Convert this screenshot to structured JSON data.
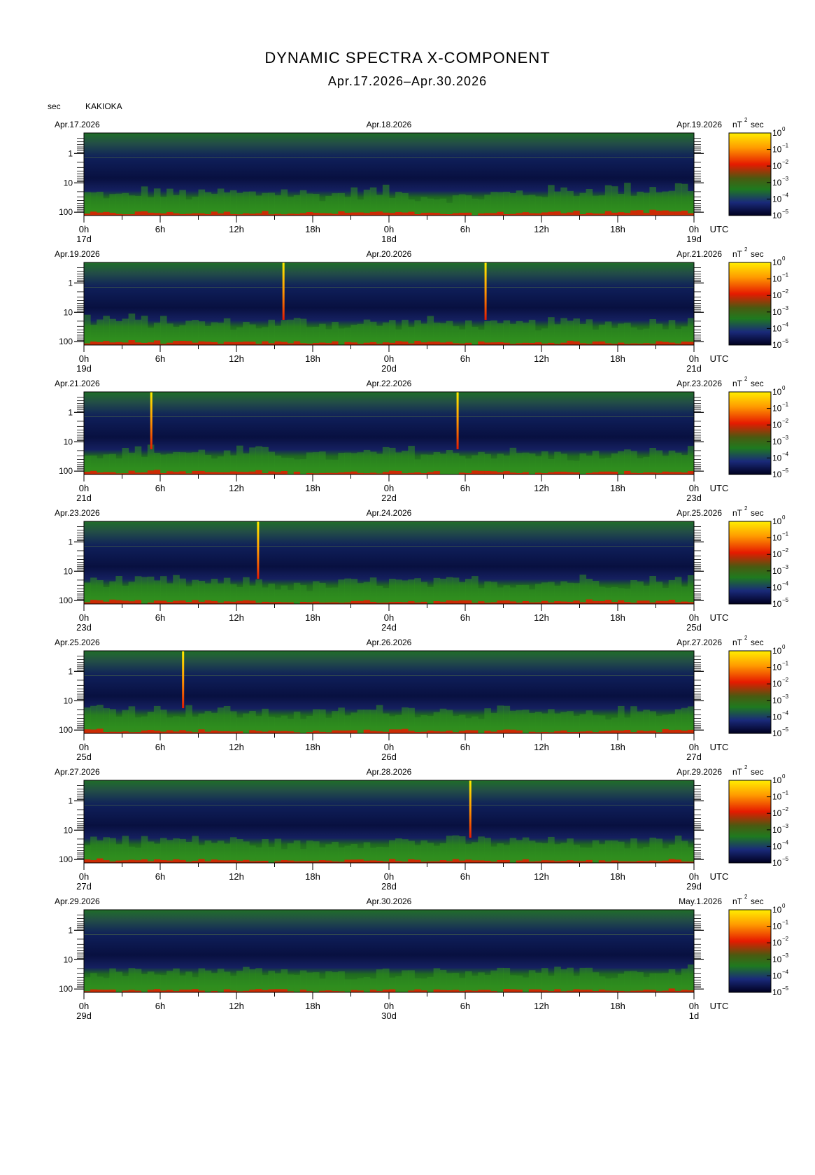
{
  "chart_data": {
    "type": "heatmap",
    "title": "DYNAMIC SPECTRA X-COMPONENT",
    "subtitle": "Apr.17.2026–Apr.30.2026",
    "station": "KAKIOKA",
    "y_unit": "sec",
    "y_ticks": [
      "1",
      "10",
      "100"
    ],
    "y_range_sec": [
      0.2,
      130
    ],
    "x_ticks": [
      "0h",
      "6h",
      "12h",
      "18h",
      "0h",
      "6h",
      "12h",
      "18h",
      "0h"
    ],
    "x_unit": "UTC",
    "colorbar_unit_base": "nT",
    "colorbar_unit_exp": "2",
    "colorbar_unit_suffix": "sec",
    "colorbar_base": "10",
    "colorbar_exponents": [
      "0",
      "−1",
      "−2",
      "−3",
      "−4",
      "−5"
    ],
    "colors": {
      "low": "#000020",
      "mid_low": "#1a2a7a",
      "mid": "#1f7a1f",
      "high": "#e61a00",
      "top": "#ffee00"
    },
    "panels": [
      {
        "start_label": "Apr.17.2026",
        "mid_label": "Apr.18.2026",
        "end_label": "Apr.19.2026",
        "day_labels": [
          "17d",
          "18d",
          "19d"
        ],
        "spikes": [],
        "activity": [
          0.5,
          0.4,
          0.6,
          0.5,
          0.45,
          0.55,
          0.5,
          0.6,
          0.5,
          0.45,
          0.55,
          0.6,
          0.5,
          0.4,
          0.35,
          0.4,
          0.5,
          0.55,
          0.6,
          0.65,
          0.7,
          0.7,
          0.75,
          0.8
        ]
      },
      {
        "start_label": "Apr.19.2026",
        "mid_label": "Apr.20.2026",
        "end_label": "Apr.21.2026",
        "day_labels": [
          "19d",
          "20d",
          "21d"
        ],
        "spikes": [
          15.7,
          31.6
        ],
        "activity": [
          0.7,
          0.65,
          0.6,
          0.55,
          0.5,
          0.5,
          0.45,
          0.5,
          0.55,
          0.5,
          0.45,
          0.5,
          0.5,
          0.55,
          0.5,
          0.45,
          0.4,
          0.45,
          0.5,
          0.55,
          0.5,
          0.45,
          0.5,
          0.55
        ]
      },
      {
        "start_label": "Apr.21.2026",
        "mid_label": "Apr.22.2026",
        "end_label": "Apr.23.2026",
        "day_labels": [
          "21d",
          "22d",
          "23d"
        ],
        "spikes": [
          5.3,
          29.4
        ],
        "activity": [
          0.55,
          0.5,
          0.6,
          0.55,
          0.5,
          0.45,
          0.55,
          0.5,
          0.4,
          0.35,
          0.4,
          0.5,
          0.55,
          0.5,
          0.45,
          0.5,
          0.5,
          0.45,
          0.4,
          0.35,
          0.4,
          0.45,
          0.5,
          0.55
        ]
      },
      {
        "start_label": "Apr.23.2026",
        "mid_label": "Apr.24.2026",
        "end_label": "Apr.25.2026",
        "day_labels": [
          "23d",
          "24d",
          "25d"
        ],
        "spikes": [
          13.7
        ],
        "activity": [
          0.6,
          0.55,
          0.5,
          0.55,
          0.5,
          0.45,
          0.5,
          0.4,
          0.3,
          0.35,
          0.45,
          0.5,
          0.5,
          0.45,
          0.5,
          0.55,
          0.5,
          0.45,
          0.5,
          0.6,
          0.55,
          0.5,
          0.55,
          0.6
        ]
      },
      {
        "start_label": "Apr.25.2026",
        "mid_label": "Apr.26.2026",
        "end_label": "Apr.27.2026",
        "day_labels": [
          "25d",
          "26d",
          "27d"
        ],
        "spikes": [
          7.8
        ],
        "activity": [
          0.65,
          0.6,
          0.55,
          0.5,
          0.55,
          0.5,
          0.45,
          0.4,
          0.35,
          0.4,
          0.5,
          0.55,
          0.6,
          0.55,
          0.5,
          0.45,
          0.5,
          0.45,
          0.4,
          0.35,
          0.4,
          0.5,
          0.55,
          0.6
        ]
      },
      {
        "start_label": "Apr.27.2026",
        "mid_label": "Apr.28.2026",
        "end_label": "Apr.29.2026",
        "day_labels": [
          "27d",
          "28d",
          "29d"
        ],
        "spikes": [
          30.4
        ],
        "activity": [
          0.6,
          0.55,
          0.5,
          0.55,
          0.5,
          0.5,
          0.45,
          0.4,
          0.35,
          0.4,
          0.45,
          0.5,
          0.5,
          0.45,
          0.5,
          0.5,
          0.45,
          0.5,
          0.45,
          0.4,
          0.35,
          0.4,
          0.45,
          0.5
        ]
      },
      {
        "start_label": "Apr.29.2026",
        "mid_label": "Apr.30.2026",
        "end_label": "May.1.2026",
        "day_labels": [
          "29d",
          "30d",
          "1d"
        ],
        "spikes": [],
        "activity": [
          0.45,
          0.4,
          0.45,
          0.5,
          0.45,
          0.4,
          0.45,
          0.5,
          0.35,
          0.3,
          0.35,
          0.4,
          0.45,
          0.4,
          0.45,
          0.5,
          0.45,
          0.4,
          0.45,
          0.4,
          0.35,
          0.4,
          0.45,
          0.5
        ]
      }
    ]
  }
}
